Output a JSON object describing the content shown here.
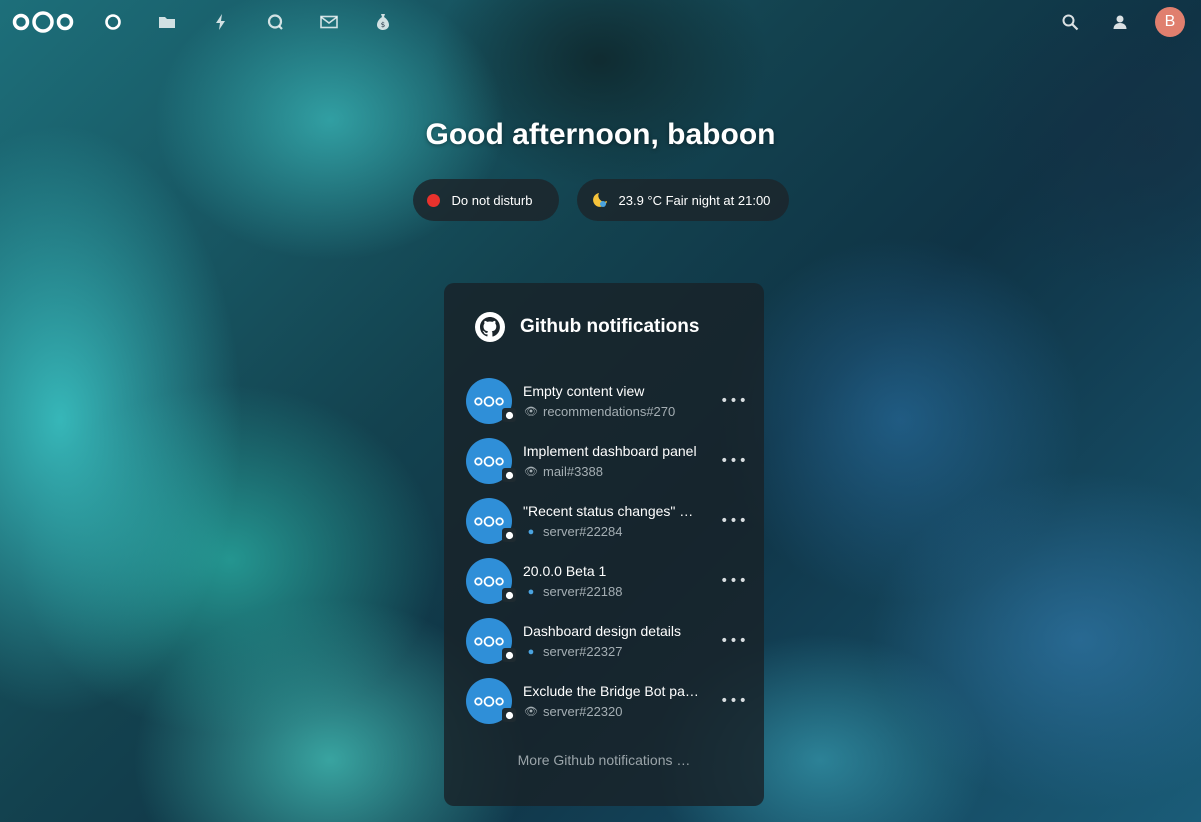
{
  "header": {
    "nav_icons": [
      "dashboard-icon",
      "files-icon",
      "activity-icon",
      "talk-icon",
      "mail-icon",
      "money-icon"
    ],
    "right_icons": [
      "search-icon",
      "contacts-icon"
    ],
    "avatar_initial": "B"
  },
  "greeting": "Good afternoon, baboon",
  "status": {
    "dnd_label": "Do not disturb",
    "weather_label": "23.9 °C Fair night at 21:00"
  },
  "panel": {
    "title": "Github notifications",
    "items": [
      {
        "title": "Empty content view",
        "sub": "recommendations#270",
        "sub_icon": "eye-icon"
      },
      {
        "title": "Implement dashboard panel",
        "sub": "mail#3388",
        "sub_icon": "eye-icon"
      },
      {
        "title": "\"Recent status changes\" …",
        "sub": "server#22284",
        "sub_icon": "chat-bubble-icon"
      },
      {
        "title": "20.0.0 Beta 1",
        "sub": "server#22188",
        "sub_icon": "chat-bubble-icon"
      },
      {
        "title": "Dashboard design details",
        "sub": "server#22327",
        "sub_icon": "chat-bubble-icon"
      },
      {
        "title": "Exclude the Bridge Bot pa…",
        "sub": "server#22320",
        "sub_icon": "eye-icon"
      }
    ],
    "more_label": "More Github notifications …"
  },
  "colors": {
    "accent_avatar": "#e07f6e",
    "dnd_red": "#e9322d",
    "item_avatar_blue": "#2f8fd8"
  }
}
